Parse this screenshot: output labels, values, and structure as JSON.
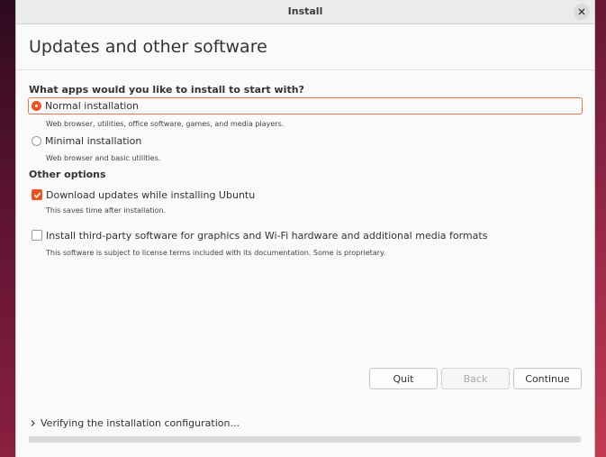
{
  "window": {
    "title": "Install",
    "page_title": "Updates and other software"
  },
  "apps_section": {
    "heading": "What apps would you like to install to start with?",
    "options": [
      {
        "label": "Normal installation",
        "description": "Web browser, utilities, office software, games, and media players.",
        "selected": true
      },
      {
        "label": "Minimal installation",
        "description": "Web browser and basic utilities.",
        "selected": false
      }
    ]
  },
  "other_section": {
    "heading": "Other options",
    "options": [
      {
        "label": "Download updates while installing Ubuntu",
        "description": "This saves time after installation.",
        "checked": true
      },
      {
        "label": "Install third-party software for graphics and Wi-Fi hardware and additional media formats",
        "description": "This software is subject to license terms included with its documentation. Some is proprietary.",
        "checked": false
      }
    ]
  },
  "buttons": {
    "quit": "Quit",
    "back": "Back",
    "continue": "Continue"
  },
  "status": {
    "text": "Verifying the installation configuration...",
    "progress": 0
  },
  "colors": {
    "accent": "#e95420"
  }
}
